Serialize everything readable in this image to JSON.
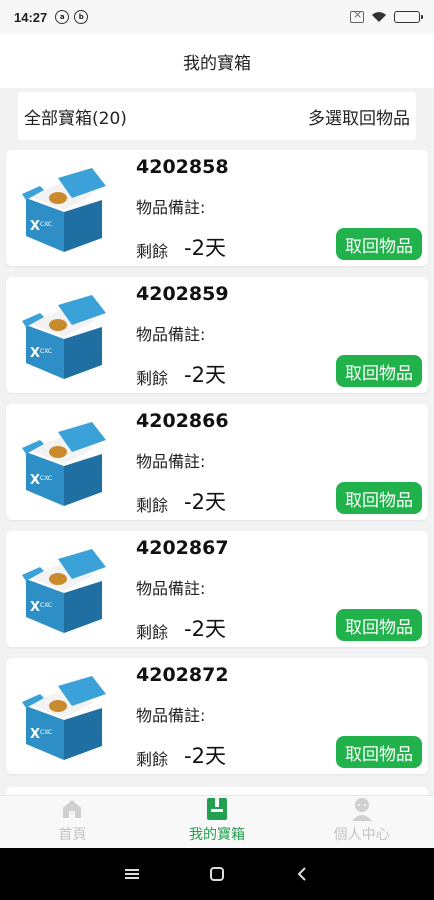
{
  "status_bar": {
    "time": "14:27",
    "notif_icons": [
      "a",
      "b"
    ],
    "battery_color": "#2db84b"
  },
  "header": {
    "title": "我的寶箱"
  },
  "toolbar": {
    "all_label": "全部寶箱(20)",
    "multi_label": "多選取回物品"
  },
  "items": [
    {
      "id": "4202858",
      "note_label": "物品備註:",
      "remain_label": "剩餘",
      "remain_days": "-2天",
      "button_label": "取回物品"
    },
    {
      "id": "4202859",
      "note_label": "物品備註:",
      "remain_label": "剩餘",
      "remain_days": "-2天",
      "button_label": "取回物品"
    },
    {
      "id": "4202866",
      "note_label": "物品備註:",
      "remain_label": "剩餘",
      "remain_days": "-2天",
      "button_label": "取回物品"
    },
    {
      "id": "4202867",
      "note_label": "物品備註:",
      "remain_label": "剩餘",
      "remain_days": "-2天",
      "button_label": "取回物品"
    },
    {
      "id": "4202872",
      "note_label": "物品備註:",
      "remain_label": "剩餘",
      "remain_days": "-2天",
      "button_label": "取回物品"
    }
  ],
  "bottom_nav": [
    {
      "label": "首頁",
      "icon": "home-icon",
      "active": false
    },
    {
      "label": "我的寶箱",
      "icon": "box-icon",
      "active": true
    },
    {
      "label": "個人中心",
      "icon": "person-icon",
      "active": false
    }
  ],
  "colors": {
    "accent": "#22b24c",
    "nav_active": "#22a050",
    "nav_inactive": "#c4c4c4",
    "box_blue": "#2e8fc7"
  }
}
